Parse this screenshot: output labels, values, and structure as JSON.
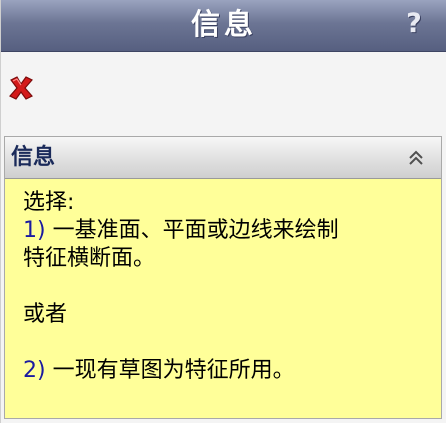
{
  "window": {
    "title": "信息",
    "help_label": "?"
  },
  "toolbar": {
    "close_icon": "close-x-icon",
    "close_color": "#cc1111"
  },
  "panel": {
    "title": "信息",
    "collapse_icon": "double-chevron-up-icon",
    "background": "#ffff99",
    "lines": {
      "line1": "选择:",
      "line2_num": "1)",
      "line2_text": " 一基准面、平面或边线来绘制",
      "line3": "特征横断面。",
      "line4": "或者",
      "line5_num": "2)",
      "line5_text": " 一现有草图为特征所用。"
    }
  }
}
